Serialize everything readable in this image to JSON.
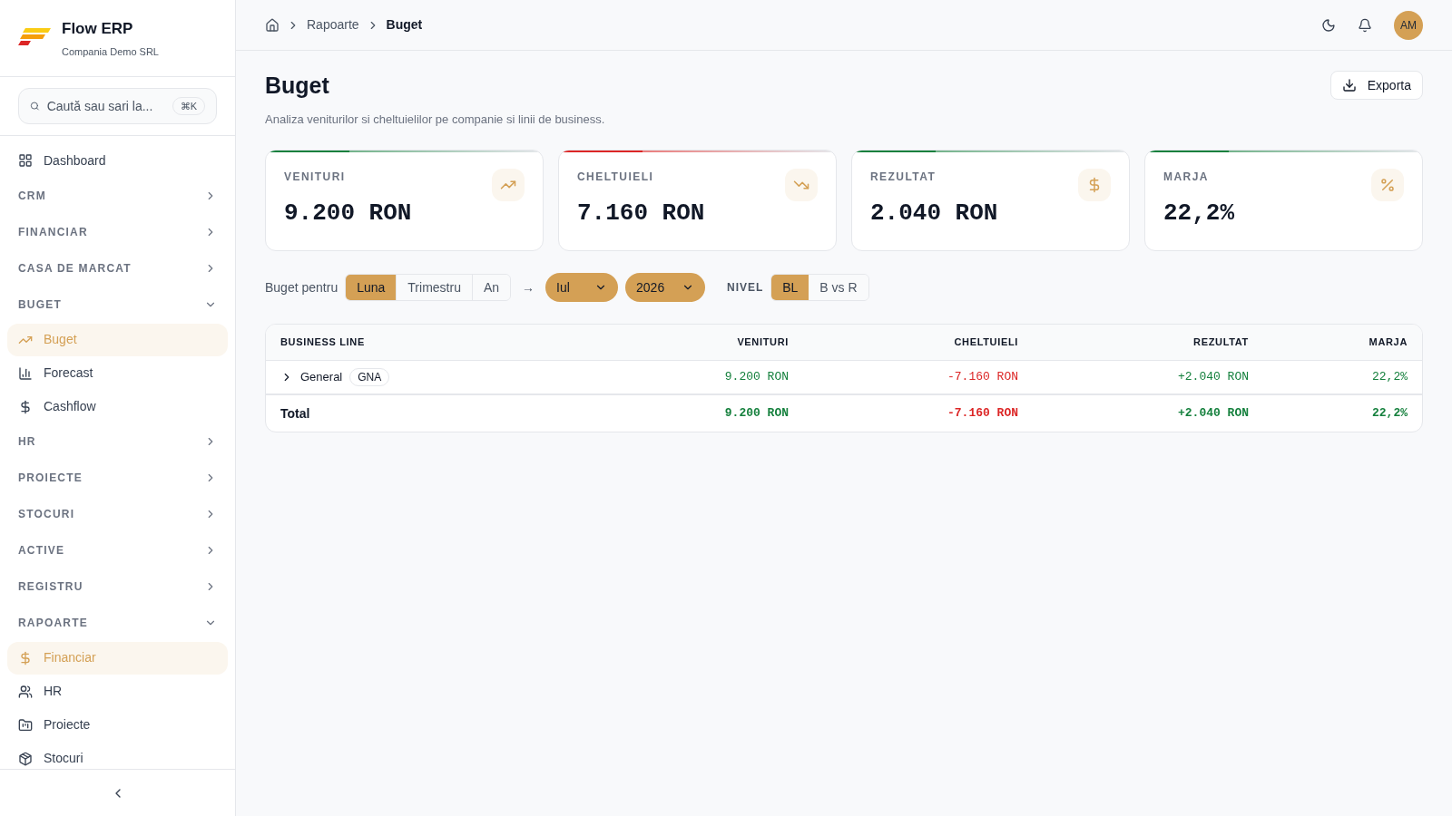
{
  "brand": {
    "name": "Flow ERP",
    "company": "Compania Demo SRL"
  },
  "search": {
    "placeholder": "Caută sau sari la...",
    "shortcut": "⌘K"
  },
  "nav": [
    {
      "kind": "link",
      "label": "Dashboard",
      "selected": false
    },
    {
      "kind": "section",
      "label": "CRM",
      "expanded": false
    },
    {
      "kind": "section",
      "label": "FINANCIAR",
      "expanded": false
    },
    {
      "kind": "section",
      "label": "CASA DE MARCAT",
      "expanded": false
    },
    {
      "kind": "section",
      "label": "BUGET",
      "expanded": true,
      "children": [
        {
          "label": "Buget",
          "selected": true
        },
        {
          "label": "Forecast",
          "selected": false
        },
        {
          "label": "Cashflow",
          "selected": false
        }
      ]
    },
    {
      "kind": "section",
      "label": "HR",
      "expanded": false
    },
    {
      "kind": "section",
      "label": "PROIECTE",
      "expanded": false
    },
    {
      "kind": "section",
      "label": "STOCURI",
      "expanded": false
    },
    {
      "kind": "section",
      "label": "ACTIVE",
      "expanded": false
    },
    {
      "kind": "section",
      "label": "REGISTRU",
      "expanded": false
    },
    {
      "kind": "section",
      "label": "RAPOARTE",
      "expanded": true,
      "children": [
        {
          "label": "Financiar",
          "selected": true
        },
        {
          "label": "HR",
          "selected": false
        },
        {
          "label": "Proiecte",
          "selected": false
        },
        {
          "label": "Stocuri",
          "selected": false
        }
      ]
    }
  ],
  "breadcrumb": [
    "Rapoarte",
    "Buget"
  ],
  "user": {
    "initials": "AM"
  },
  "page": {
    "title": "Buget",
    "subtitle": "Analiza veniturilor si cheltuielilor pe companie si linii de business.",
    "export": "Exporta"
  },
  "kpis": [
    {
      "label": "VENITURI",
      "value": "9.200 RON",
      "color": "#15803d"
    },
    {
      "label": "CHELTUIELI",
      "value": "7.160 RON",
      "color": "#dc2626"
    },
    {
      "label": "REZULTAT",
      "value": "2.040 RON",
      "color": "#15803d"
    },
    {
      "label": "MARJA",
      "value": "22,2%",
      "color": "#15803d"
    }
  ],
  "filters": {
    "label": "Buget pentru",
    "periods": [
      {
        "label": "Luna",
        "selected": true
      },
      {
        "label": "Trimestru",
        "selected": false
      },
      {
        "label": "An",
        "selected": false
      }
    ],
    "arrow": "→",
    "month": "Iul",
    "year": "2026",
    "level_label": "NIVEL",
    "levels": [
      {
        "label": "BL",
        "selected": true
      },
      {
        "label": "B vs R",
        "selected": false
      }
    ]
  },
  "table": {
    "columns": [
      "BUSINESS LINE",
      "VENITURI",
      "CHELTUIELI",
      "REZULTAT",
      "MARJA"
    ],
    "rows": [
      {
        "tag": "GNA",
        "expanded": false,
        "cells": [
          "General",
          "9.200 RON",
          "-7.160 RON",
          "+2.040 RON",
          "22,2%"
        ]
      }
    ],
    "total": {
      "cells": [
        "Total",
        "9.200 RON",
        "-7.160 RON",
        "+2.040 RON",
        "22,2%"
      ]
    }
  }
}
